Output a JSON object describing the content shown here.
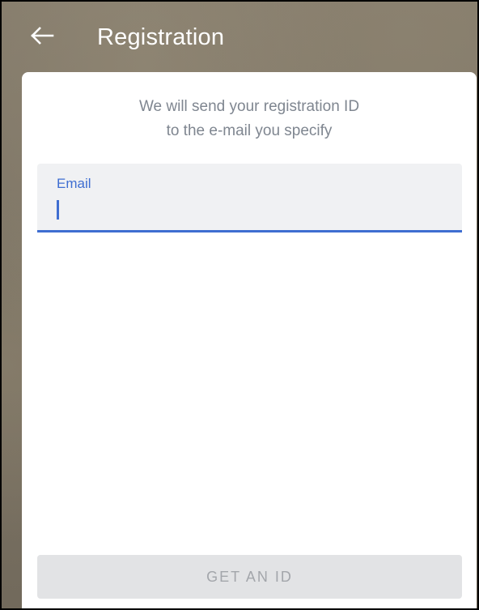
{
  "header": {
    "back_icon": "arrow-left-icon",
    "title": "Registration"
  },
  "card": {
    "subtitle_line1": "We will send your registration ID",
    "subtitle_line2": "to the e-mail you specify"
  },
  "email_field": {
    "label": "Email",
    "value": "",
    "state": "focused"
  },
  "actions": {
    "get_id_label": "GET AN ID",
    "get_id_enabled": false
  },
  "colors": {
    "accent": "#3f6ed1",
    "subtitle_text": "#7f8690",
    "disabled_button_bg": "#e2e3e5",
    "disabled_button_text": "#a3a6ab"
  }
}
